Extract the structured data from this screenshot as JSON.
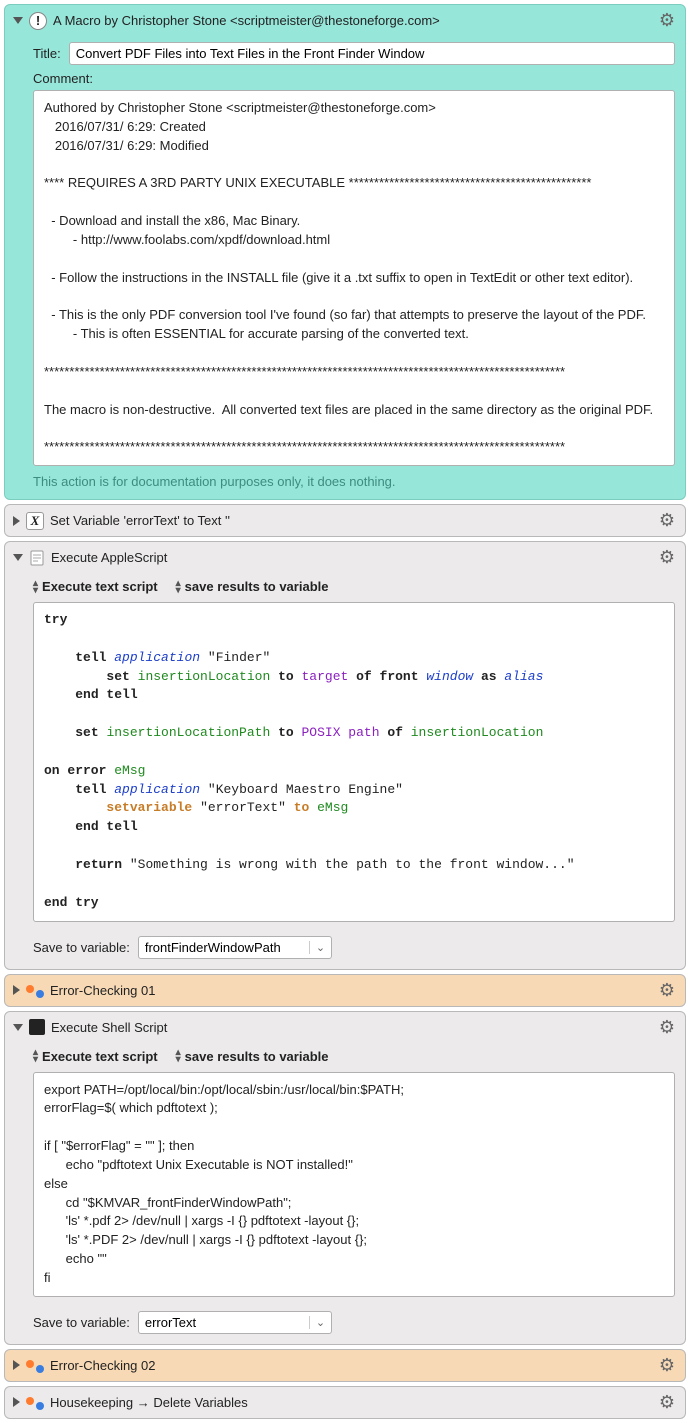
{
  "macro": {
    "header": "A Macro by Christopher Stone <scriptmeister@thestoneforge.com>",
    "title_label": "Title:",
    "title_value": "Convert PDF Files into Text Files in the Front Finder Window",
    "comment_label": "Comment:",
    "comment_body": "Authored by Christopher Stone <scriptmeister@thestoneforge.com>\n   2016/07/31/ 6:29: Created\n   2016/07/31/ 6:29: Modified\n\n**** REQUIRES A 3RD PARTY UNIX EXECUTABLE ************************************************\n\n  - Download and install the x86, Mac Binary.\n        - http://www.foolabs.com/xpdf/download.html\n\n  - Follow the instructions in the INSTALL file (give it a .txt suffix to open in TextEdit or other text editor).\n\n  - This is the only PDF conversion tool I've found (so far) that attempts to preserve the layout of the PDF.\n        - This is often ESSENTIAL for accurate parsing of the converted text.\n\n*******************************************************************************************************\n\nThe macro is non-destructive.  All converted text files are placed in the same directory as the original PDF.\n\n*******************************************************************************************************",
    "footnote": "This action is for documentation purposes only, it does nothing."
  },
  "set_variable": {
    "title": "Set Variable 'errorText' to Text ''"
  },
  "applescript": {
    "title": "Execute AppleScript",
    "selector1": "Execute text script",
    "selector2": "save results to variable",
    "save_label": "Save to variable:",
    "save_value": "frontFinderWindowPath",
    "code": {
      "l1": "try",
      "l2a": "tell",
      "l2b": "application",
      "l2c": "\"Finder\"",
      "l3a": "set",
      "l3b": "insertionLocation",
      "l3c": "to",
      "l3d": "target",
      "l3e": "of front",
      "l3f": "window",
      "l3g": "as",
      "l3h": "alias",
      "l4": "end tell",
      "l5a": "set",
      "l5b": "insertionLocationPath",
      "l5c": "to",
      "l5d": "POSIX path",
      "l5e": "of",
      "l5f": "insertionLocation",
      "l6a": "on error",
      "l6b": "eMsg",
      "l7a": "tell",
      "l7b": "application",
      "l7c": "\"Keyboard Maestro Engine\"",
      "l8a": "setvariable",
      "l8b": "\"errorText\"",
      "l8c": "to",
      "l8d": "eMsg",
      "l9": "end tell",
      "l10a": "return",
      "l10b": "\"Something is wrong with the path to the front window...\"",
      "l11": "end try"
    }
  },
  "error1": {
    "title": "Error-Checking 01"
  },
  "shell": {
    "title": "Execute Shell Script",
    "selector1": "Execute text script",
    "selector2": "save results to variable",
    "body": "export PATH=/opt/local/bin:/opt/local/sbin:/usr/local/bin:$PATH;\nerrorFlag=$( which pdftotext );\n\nif [ \"$errorFlag\" = \"\" ]; then\n      echo \"pdftotext Unix Executable is NOT installed!\"\nelse\n      cd \"$KMVAR_frontFinderWindowPath\";\n      'ls' *.pdf 2> /dev/null | xargs -I {} pdftotext -layout {};\n      'ls' *.PDF 2> /dev/null | xargs -I {} pdftotext -layout {};\n      echo \"\"\nfi",
    "save_label": "Save to variable:",
    "save_value": "errorText"
  },
  "error2": {
    "title": "Error-Checking 02"
  },
  "housekeeping": {
    "title": "Housekeeping → Delete Variables"
  }
}
